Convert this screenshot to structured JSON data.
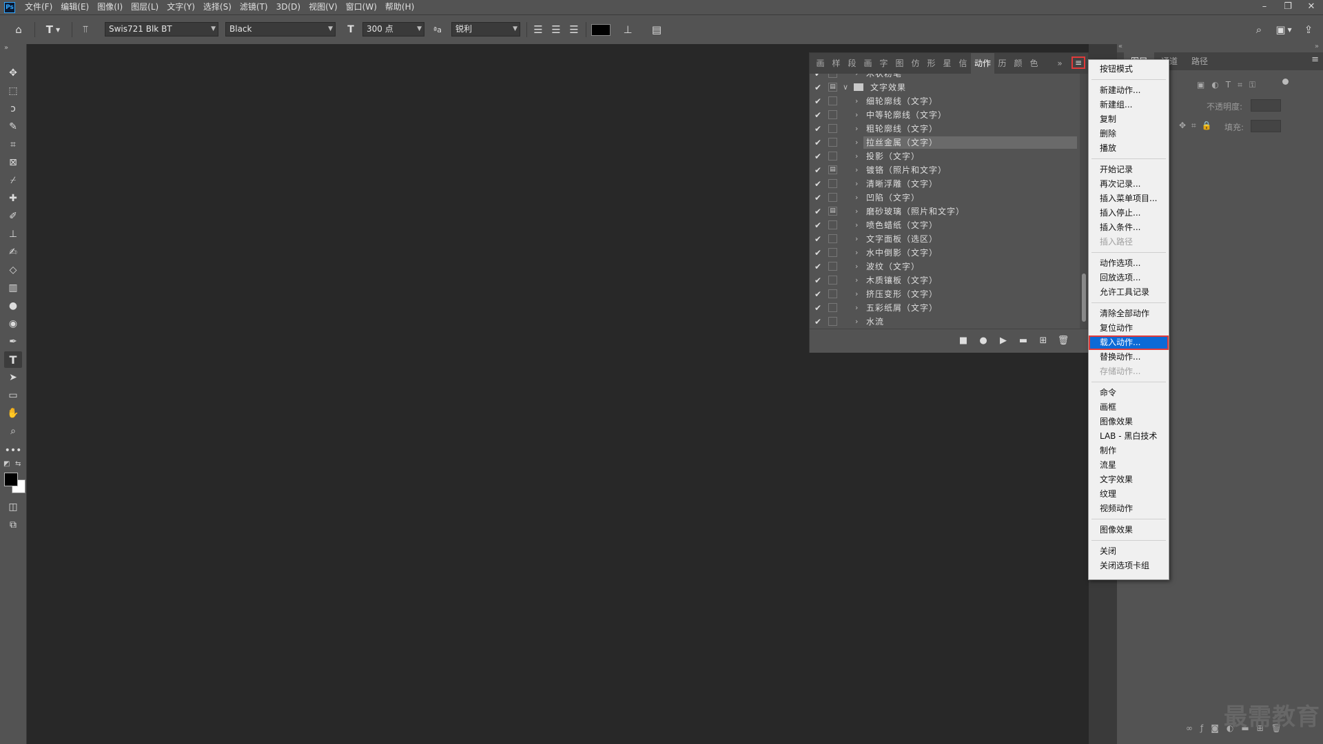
{
  "menubar": {
    "items": [
      "文件(F)",
      "编辑(E)",
      "图像(I)",
      "图层(L)",
      "文字(Y)",
      "选择(S)",
      "滤镜(T)",
      "3D(D)",
      "视图(V)",
      "窗口(W)",
      "帮助(H)"
    ],
    "logo": "Ps"
  },
  "window_controls": {
    "minimize": "–",
    "restore": "❐",
    "close": "✕"
  },
  "options": {
    "font_family": "Swis721 Blk BT",
    "font_style": "Black",
    "font_size": "300 点",
    "antialias_label": "ªa",
    "antialias": "锐利",
    "size_icon": "T",
    "color": "#000000"
  },
  "actions_panel": {
    "tabs": [
      "画",
      "样",
      "段",
      "画",
      "字",
      "图",
      "仿",
      "形",
      "星",
      "信",
      "动作",
      "历",
      "颜",
      "色"
    ],
    "active_tab": "动作",
    "rows": [
      {
        "name": "木状粉笔",
        "indent": 1,
        "dialog": false
      },
      {
        "name": "文字效果",
        "indent": 0,
        "dialog": true,
        "folder": true
      },
      {
        "name": "细轮廓线（文字）",
        "indent": 1,
        "dialog": false
      },
      {
        "name": "中等轮廓线（文字）",
        "indent": 1,
        "dialog": false
      },
      {
        "name": "粗轮廓线（文字）",
        "indent": 1,
        "dialog": false
      },
      {
        "name": "拉丝金属（文字）",
        "indent": 1,
        "dialog": false,
        "highlight": true
      },
      {
        "name": "投影（文字）",
        "indent": 1,
        "dialog": false
      },
      {
        "name": "镀铬（照片和文字）",
        "indent": 1,
        "dialog": true
      },
      {
        "name": "清晰浮雕（文字）",
        "indent": 1,
        "dialog": false
      },
      {
        "name": "凹陷（文字）",
        "indent": 1,
        "dialog": false
      },
      {
        "name": "磨砂玻璃（照片和文字）",
        "indent": 1,
        "dialog": true
      },
      {
        "name": "喷色蜡纸（文字）",
        "indent": 1,
        "dialog": false
      },
      {
        "name": "文字面板（选区）",
        "indent": 1,
        "dialog": false
      },
      {
        "name": "水中倒影（文字）",
        "indent": 1,
        "dialog": false
      },
      {
        "name": "波纹（文字）",
        "indent": 1,
        "dialog": false
      },
      {
        "name": "木质镶板（文字）",
        "indent": 1,
        "dialog": false
      },
      {
        "name": "挤压变形（文字）",
        "indent": 1,
        "dialog": false
      },
      {
        "name": "五彩纸屑（文字）",
        "indent": 1,
        "dialog": false
      },
      {
        "name": "水流",
        "indent": 1,
        "dialog": false
      }
    ],
    "check_glyph": "✔",
    "collapse_glyph": "»",
    "menu_glyph": "≡"
  },
  "layers_dock": {
    "tabs": [
      "图层",
      "通道",
      "路径"
    ],
    "opacity_label": "不透明度:",
    "fill_label": "填充:",
    "collapse_glyph": "«"
  },
  "flyout_menu": {
    "groups": [
      [
        {
          "label": "按钮模式"
        }
      ],
      [
        {
          "label": "新建动作..."
        },
        {
          "label": "新建组..."
        },
        {
          "label": "复制"
        },
        {
          "label": "删除"
        },
        {
          "label": "播放"
        }
      ],
      [
        {
          "label": "开始记录"
        },
        {
          "label": "再次记录..."
        },
        {
          "label": "插入菜单项目..."
        },
        {
          "label": "插入停止..."
        },
        {
          "label": "插入条件..."
        },
        {
          "label": "插入路径",
          "disabled": true
        }
      ],
      [
        {
          "label": "动作选项..."
        },
        {
          "label": "回放选项..."
        },
        {
          "label": "允许工具记录"
        }
      ],
      [
        {
          "label": "清除全部动作"
        },
        {
          "label": "复位动作"
        },
        {
          "label": "载入动作...",
          "selected": true
        },
        {
          "label": "替换动作..."
        },
        {
          "label": "存储动作...",
          "disabled": true
        }
      ],
      [
        {
          "label": "命令"
        },
        {
          "label": "画框"
        },
        {
          "label": "图像效果"
        },
        {
          "label": "LAB - 黑白技术"
        },
        {
          "label": "制作"
        },
        {
          "label": "流星"
        },
        {
          "label": "文字效果"
        },
        {
          "label": "纹理"
        },
        {
          "label": "视频动作"
        }
      ],
      [
        {
          "label": "图像效果"
        }
      ],
      [
        {
          "label": "关闭"
        },
        {
          "label": "关闭选项卡组"
        }
      ]
    ]
  },
  "watermark": "最需教育",
  "colors": {
    "accent": "#0c6ad6",
    "highlight_border": "#e23a3a",
    "panel": "#535353",
    "canvas": "#282828"
  }
}
